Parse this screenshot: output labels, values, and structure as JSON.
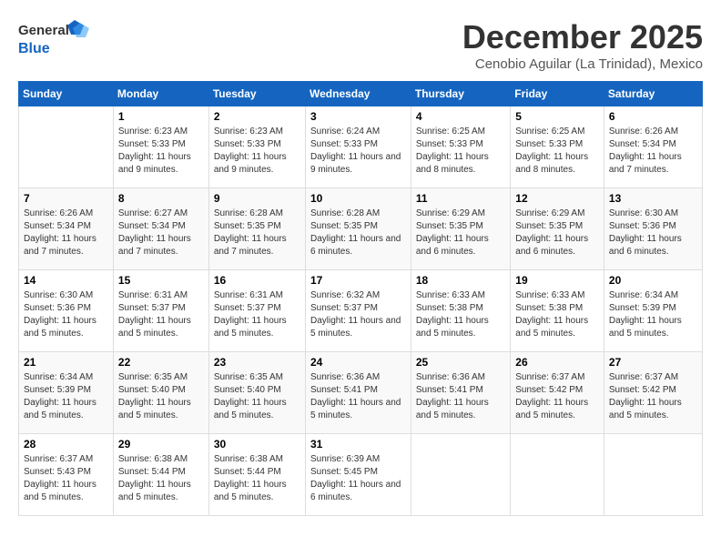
{
  "header": {
    "logo_general": "General",
    "logo_blue": "Blue",
    "month_title": "December 2025",
    "subtitle": "Cenobio Aguilar (La Trinidad), Mexico"
  },
  "days_of_week": [
    "Sunday",
    "Monday",
    "Tuesday",
    "Wednesday",
    "Thursday",
    "Friday",
    "Saturday"
  ],
  "weeks": [
    [
      {
        "day": "",
        "sunrise": "",
        "sunset": "",
        "daylight": ""
      },
      {
        "day": "1",
        "sunrise": "Sunrise: 6:23 AM",
        "sunset": "Sunset: 5:33 PM",
        "daylight": "Daylight: 11 hours and 9 minutes."
      },
      {
        "day": "2",
        "sunrise": "Sunrise: 6:23 AM",
        "sunset": "Sunset: 5:33 PM",
        "daylight": "Daylight: 11 hours and 9 minutes."
      },
      {
        "day": "3",
        "sunrise": "Sunrise: 6:24 AM",
        "sunset": "Sunset: 5:33 PM",
        "daylight": "Daylight: 11 hours and 9 minutes."
      },
      {
        "day": "4",
        "sunrise": "Sunrise: 6:25 AM",
        "sunset": "Sunset: 5:33 PM",
        "daylight": "Daylight: 11 hours and 8 minutes."
      },
      {
        "day": "5",
        "sunrise": "Sunrise: 6:25 AM",
        "sunset": "Sunset: 5:33 PM",
        "daylight": "Daylight: 11 hours and 8 minutes."
      },
      {
        "day": "6",
        "sunrise": "Sunrise: 6:26 AM",
        "sunset": "Sunset: 5:34 PM",
        "daylight": "Daylight: 11 hours and 7 minutes."
      }
    ],
    [
      {
        "day": "7",
        "sunrise": "Sunrise: 6:26 AM",
        "sunset": "Sunset: 5:34 PM",
        "daylight": "Daylight: 11 hours and 7 minutes."
      },
      {
        "day": "8",
        "sunrise": "Sunrise: 6:27 AM",
        "sunset": "Sunset: 5:34 PM",
        "daylight": "Daylight: 11 hours and 7 minutes."
      },
      {
        "day": "9",
        "sunrise": "Sunrise: 6:28 AM",
        "sunset": "Sunset: 5:35 PM",
        "daylight": "Daylight: 11 hours and 7 minutes."
      },
      {
        "day": "10",
        "sunrise": "Sunrise: 6:28 AM",
        "sunset": "Sunset: 5:35 PM",
        "daylight": "Daylight: 11 hours and 6 minutes."
      },
      {
        "day": "11",
        "sunrise": "Sunrise: 6:29 AM",
        "sunset": "Sunset: 5:35 PM",
        "daylight": "Daylight: 11 hours and 6 minutes."
      },
      {
        "day": "12",
        "sunrise": "Sunrise: 6:29 AM",
        "sunset": "Sunset: 5:35 PM",
        "daylight": "Daylight: 11 hours and 6 minutes."
      },
      {
        "day": "13",
        "sunrise": "Sunrise: 6:30 AM",
        "sunset": "Sunset: 5:36 PM",
        "daylight": "Daylight: 11 hours and 6 minutes."
      }
    ],
    [
      {
        "day": "14",
        "sunrise": "Sunrise: 6:30 AM",
        "sunset": "Sunset: 5:36 PM",
        "daylight": "Daylight: 11 hours and 5 minutes."
      },
      {
        "day": "15",
        "sunrise": "Sunrise: 6:31 AM",
        "sunset": "Sunset: 5:37 PM",
        "daylight": "Daylight: 11 hours and 5 minutes."
      },
      {
        "day": "16",
        "sunrise": "Sunrise: 6:31 AM",
        "sunset": "Sunset: 5:37 PM",
        "daylight": "Daylight: 11 hours and 5 minutes."
      },
      {
        "day": "17",
        "sunrise": "Sunrise: 6:32 AM",
        "sunset": "Sunset: 5:37 PM",
        "daylight": "Daylight: 11 hours and 5 minutes."
      },
      {
        "day": "18",
        "sunrise": "Sunrise: 6:33 AM",
        "sunset": "Sunset: 5:38 PM",
        "daylight": "Daylight: 11 hours and 5 minutes."
      },
      {
        "day": "19",
        "sunrise": "Sunrise: 6:33 AM",
        "sunset": "Sunset: 5:38 PM",
        "daylight": "Daylight: 11 hours and 5 minutes."
      },
      {
        "day": "20",
        "sunrise": "Sunrise: 6:34 AM",
        "sunset": "Sunset: 5:39 PM",
        "daylight": "Daylight: 11 hours and 5 minutes."
      }
    ],
    [
      {
        "day": "21",
        "sunrise": "Sunrise: 6:34 AM",
        "sunset": "Sunset: 5:39 PM",
        "daylight": "Daylight: 11 hours and 5 minutes."
      },
      {
        "day": "22",
        "sunrise": "Sunrise: 6:35 AM",
        "sunset": "Sunset: 5:40 PM",
        "daylight": "Daylight: 11 hours and 5 minutes."
      },
      {
        "day": "23",
        "sunrise": "Sunrise: 6:35 AM",
        "sunset": "Sunset: 5:40 PM",
        "daylight": "Daylight: 11 hours and 5 minutes."
      },
      {
        "day": "24",
        "sunrise": "Sunrise: 6:36 AM",
        "sunset": "Sunset: 5:41 PM",
        "daylight": "Daylight: 11 hours and 5 minutes."
      },
      {
        "day": "25",
        "sunrise": "Sunrise: 6:36 AM",
        "sunset": "Sunset: 5:41 PM",
        "daylight": "Daylight: 11 hours and 5 minutes."
      },
      {
        "day": "26",
        "sunrise": "Sunrise: 6:37 AM",
        "sunset": "Sunset: 5:42 PM",
        "daylight": "Daylight: 11 hours and 5 minutes."
      },
      {
        "day": "27",
        "sunrise": "Sunrise: 6:37 AM",
        "sunset": "Sunset: 5:42 PM",
        "daylight": "Daylight: 11 hours and 5 minutes."
      }
    ],
    [
      {
        "day": "28",
        "sunrise": "Sunrise: 6:37 AM",
        "sunset": "Sunset: 5:43 PM",
        "daylight": "Daylight: 11 hours and 5 minutes."
      },
      {
        "day": "29",
        "sunrise": "Sunrise: 6:38 AM",
        "sunset": "Sunset: 5:44 PM",
        "daylight": "Daylight: 11 hours and 5 minutes."
      },
      {
        "day": "30",
        "sunrise": "Sunrise: 6:38 AM",
        "sunset": "Sunset: 5:44 PM",
        "daylight": "Daylight: 11 hours and 5 minutes."
      },
      {
        "day": "31",
        "sunrise": "Sunrise: 6:39 AM",
        "sunset": "Sunset: 5:45 PM",
        "daylight": "Daylight: 11 hours and 6 minutes."
      },
      {
        "day": "",
        "sunrise": "",
        "sunset": "",
        "daylight": ""
      },
      {
        "day": "",
        "sunrise": "",
        "sunset": "",
        "daylight": ""
      },
      {
        "day": "",
        "sunrise": "",
        "sunset": "",
        "daylight": ""
      }
    ]
  ]
}
